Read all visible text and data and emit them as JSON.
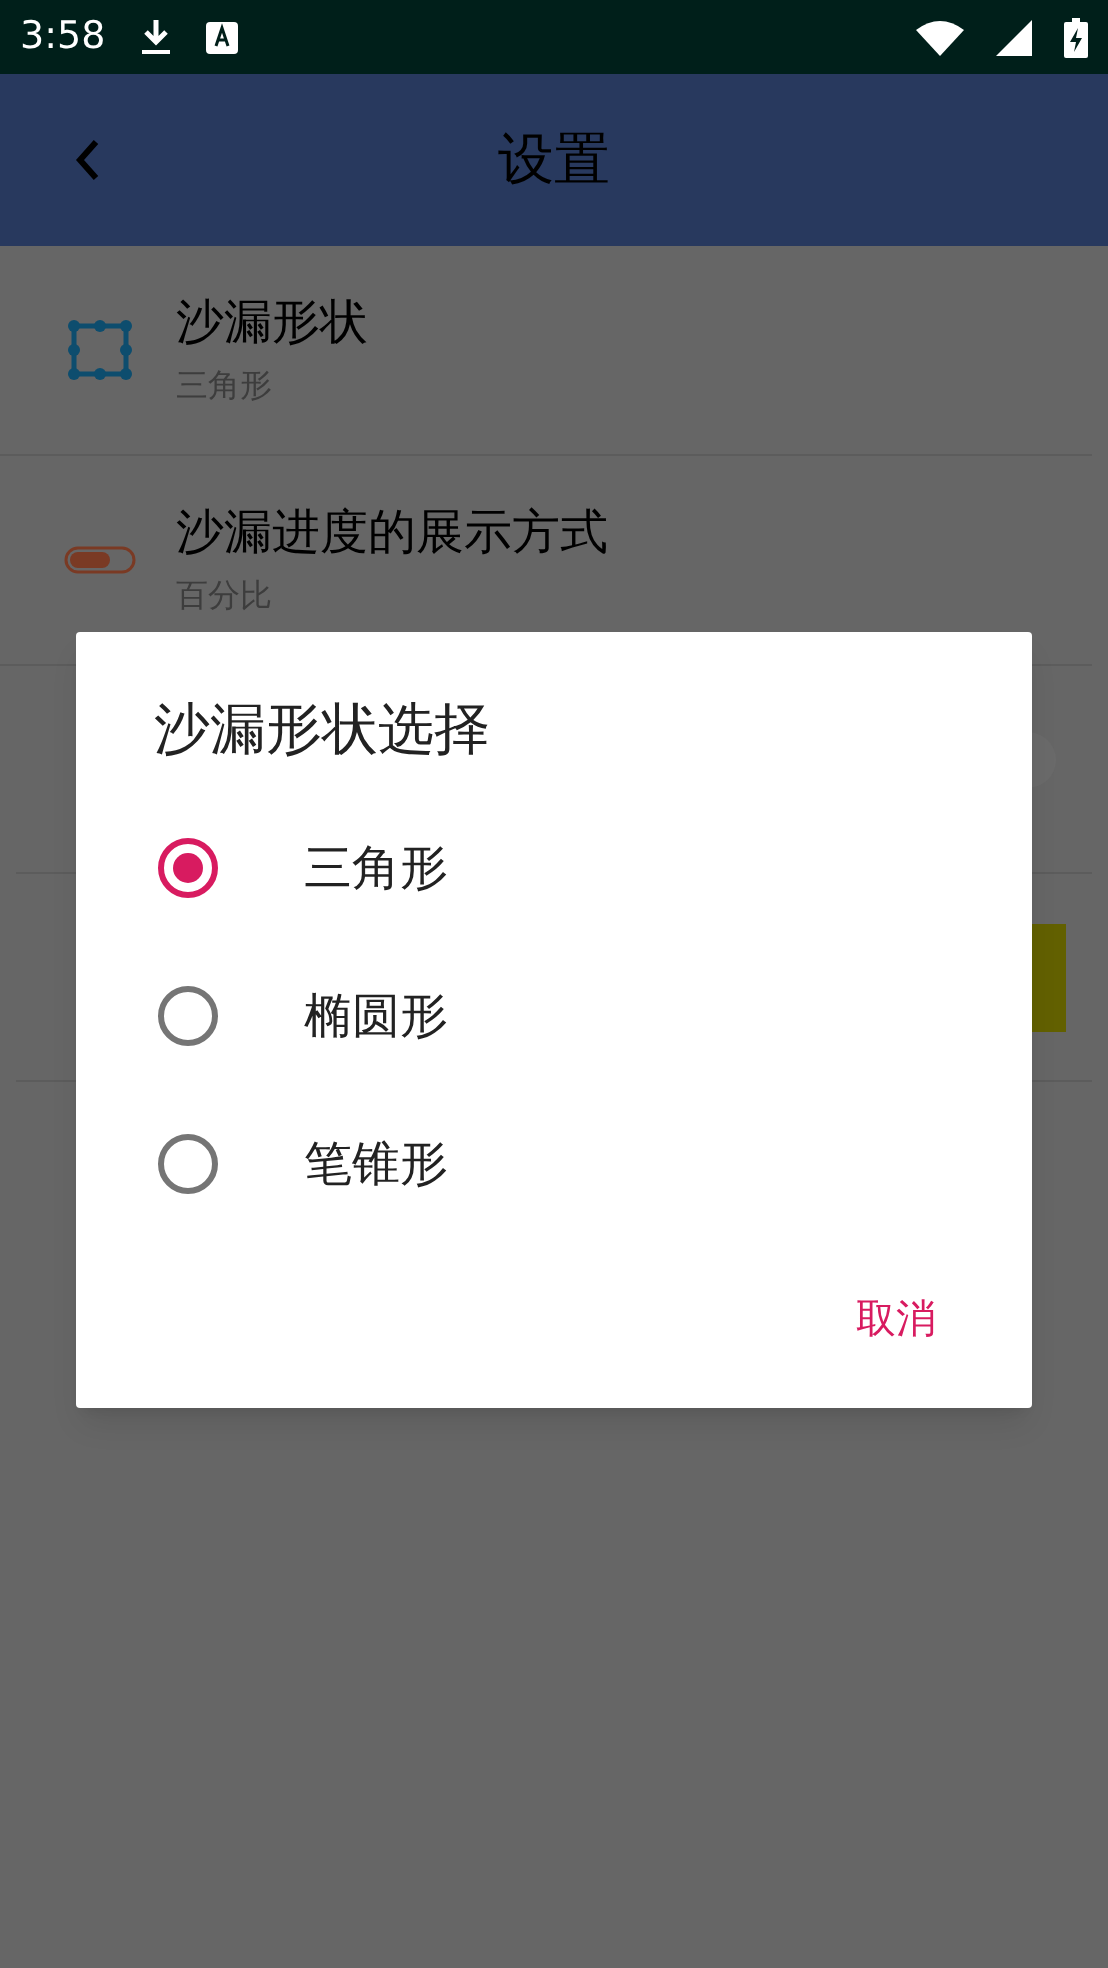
{
  "status_bar": {
    "time": "3:58"
  },
  "app_bar": {
    "title": "设置"
  },
  "settings": [
    {
      "kind": "shape",
      "title": "沙漏形状",
      "subtitle": "三角形"
    },
    {
      "kind": "progress",
      "title": "沙漏进度的展示方式",
      "subtitle": "百分比"
    }
  ],
  "dialog": {
    "title": "沙漏形状选择",
    "options": [
      {
        "label": "三角形",
        "selected": true
      },
      {
        "label": "椭圆形",
        "selected": false
      },
      {
        "label": "笔锥形",
        "selected": false
      }
    ],
    "cancel": "取消"
  }
}
